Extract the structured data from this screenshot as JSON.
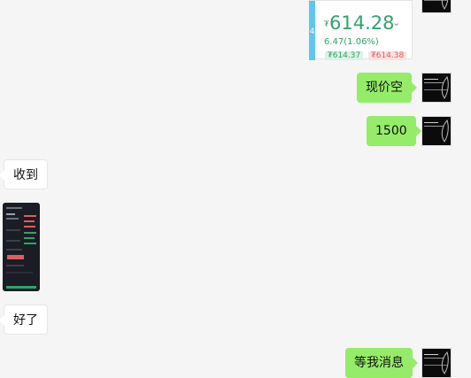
{
  "price_card": {
    "stripe_number": "4",
    "currency_symbol": "₮",
    "price": "614.28",
    "change": "6.47(1.06%)",
    "chip_bid": "₮614.37",
    "chip_ask": "₮614.38"
  },
  "messages": [
    {
      "side": "me",
      "text": "现价空"
    },
    {
      "side": "me",
      "text": "1500"
    },
    {
      "side": "other",
      "text": "收到"
    },
    {
      "side": "other",
      "text": "好了"
    },
    {
      "side": "me",
      "text": "等我消息"
    }
  ],
  "colors": {
    "me_bubble": "#95ec69",
    "other_bubble": "#ffffff",
    "background": "#f5f5f5",
    "price_up": "#2fa36b"
  }
}
